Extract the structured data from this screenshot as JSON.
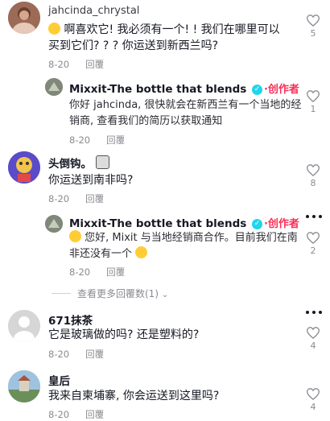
{
  "comments": [
    {
      "username": "jahcinda_chrystal",
      "text": "啊喜欢它! 我必须有一个! ! 我们在哪里可以买到它们? ? ? 你运送到新西兰吗?",
      "date": "8-20",
      "reply_label": "回覆",
      "likes": "5"
    },
    {
      "username": "Mixxit-The bottle that blends",
      "creator_label": "·创作者",
      "text": "你好 jahcinda, 很快就会在新西兰有一个当地的经销商, 查看我们的简历以获取通知",
      "date": "8-20",
      "reply_label": "回覆",
      "likes": "1"
    },
    {
      "username": "头倒钩。",
      "text": "你运送到南非吗?",
      "date": "8-20",
      "reply_label": "回覆",
      "likes": "8"
    },
    {
      "username": "Mixxit-The bottle that blends",
      "creator_label": "·创作者",
      "text": "您好, Mixit 与当地经销商合作。目前我们在南非还没有一个",
      "date": "8-20",
      "reply_label": "回覆",
      "likes": "2"
    },
    {
      "username": "671抹茶",
      "text": "它是玻璃做的吗? 还是塑料的?",
      "date": "8-20",
      "reply_label": "回覆",
      "likes": "4"
    },
    {
      "username": "皇后",
      "text": "我来自柬埔寨, 你会运送到这里吗?",
      "date": "8-20",
      "reply_label": "回覆",
      "likes": "4"
    }
  ],
  "view_more_replies": "查看更多回覆数(1)",
  "colors": {
    "creator": "#fe2c55",
    "verified": "#20d5ec",
    "muted": "#8a8b91"
  }
}
